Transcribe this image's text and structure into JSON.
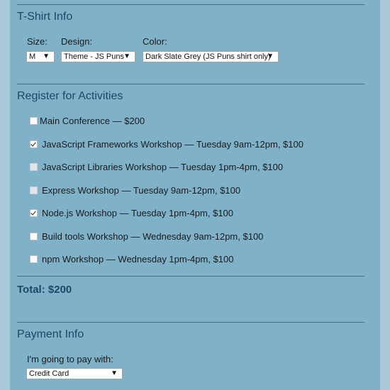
{
  "tshirt": {
    "title": "T-Shirt Info",
    "size_label": "Size:",
    "size_value": "M",
    "design_label": "Design:",
    "design_value": "Theme - JS Puns",
    "color_label": "Color:",
    "color_value": "Dark Slate Grey (JS Puns shirt only)"
  },
  "activities": {
    "title": "Register for Activities",
    "items": [
      {
        "label": "Main Conference — $200",
        "checked": false,
        "disabled": false
      },
      {
        "label": "JavaScript Frameworks Workshop — Tuesday 9am-12pm, $100",
        "checked": true,
        "disabled": false
      },
      {
        "label": "JavaScript Libraries Workshop — Tuesday 1pm-4pm, $100",
        "checked": false,
        "disabled": true
      },
      {
        "label": "Express Workshop — Tuesday 9am-12pm, $100",
        "checked": false,
        "disabled": true
      },
      {
        "label": "Node.js Workshop — Tuesday 1pm-4pm, $100",
        "checked": true,
        "disabled": false
      },
      {
        "label": "Build tools Workshop — Wednesday 9am-12pm, $100",
        "checked": false,
        "disabled": false
      },
      {
        "label": "npm Workshop — Wednesday 1pm-4pm, $100",
        "checked": false,
        "disabled": false
      }
    ],
    "total": "Total: $200"
  },
  "payment": {
    "title": "Payment Info",
    "method_label": "I'm going to pay with:",
    "method_value": "Credit Card"
  },
  "colors": {
    "background": "#7fb2c9",
    "heading": "#184b63",
    "rule": "#3f6f86"
  }
}
